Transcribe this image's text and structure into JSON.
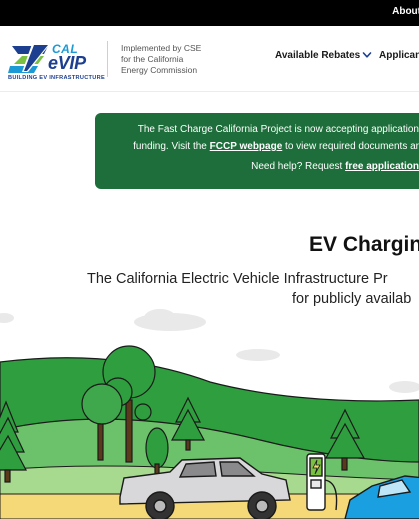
{
  "topbar": {
    "about_link": "About"
  },
  "header": {
    "logo": {
      "cal": "CAL",
      "evip": "eVIP",
      "tagline": "BUILDING EV INFRASTRUCTURE"
    },
    "implemented_lines": [
      "Implemented by CSE",
      "for the California",
      "Energy Commission"
    ],
    "nav": {
      "rebates": "Available Rebates",
      "applicants": "Applican"
    }
  },
  "banner": {
    "line1": "The Fast Charge California Project is now accepting application",
    "line2_pre": "funding. Visit the ",
    "line2_link": "FCCP webpage",
    "line2_post": " to view required documents ar",
    "line3_pre": "Need help? Request ",
    "line3_link": "free application"
  },
  "hero": {
    "title": "EV Chargin",
    "subtitle_line1": "The California Electric Vehicle Infrastructure Pr",
    "subtitle_line2": "for publicly availab"
  },
  "colors": {
    "banner_bg": "#1d6e3a",
    "hill_green": "#2f9e3f",
    "hill_light": "#6cc26a",
    "logo_blue": "#1d3f8f",
    "logo_cyan": "#1c9ad6",
    "charger_green": "#7ac143",
    "car_blue": "#1aa0e0"
  },
  "icons": {
    "nav_dropdown": "chevron-down-icon"
  }
}
